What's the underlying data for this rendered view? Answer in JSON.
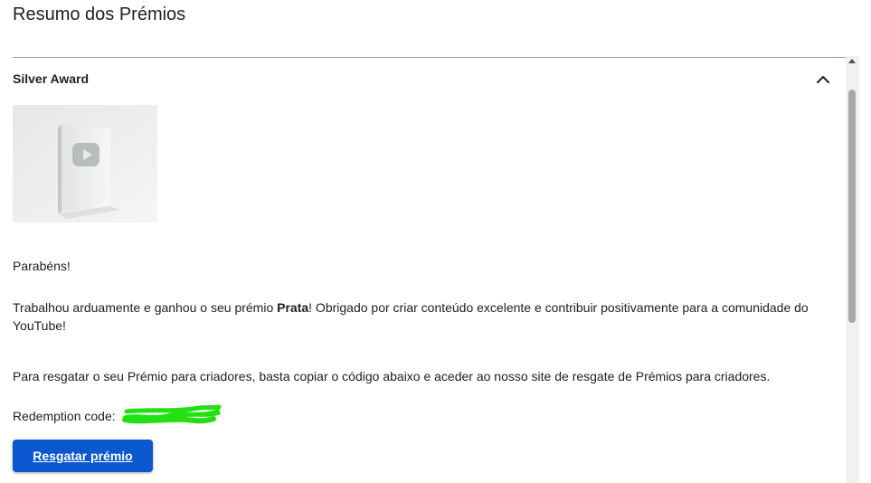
{
  "page": {
    "title": "Resumo dos Prémios"
  },
  "award": {
    "title": "Silver Award",
    "expanded": true,
    "image_description_icon": "youtube-silver-play-button-plaque"
  },
  "message": {
    "congrats": "Parabéns!",
    "body_before": "Trabalhou arduamente e ganhou o seu prémio ",
    "body_bold": "Prata",
    "body_after": "! Obrigado por criar conteúdo excelente e contribuir positivamente para a comunidade do YouTube!",
    "redeem_instructions": "Para resgatar o seu Prémio para criadores, basta copiar o código abaixo e aceder ao nosso site de resgate de Prémios para criadores.",
    "code_label": "Redemption code:"
  },
  "button": {
    "label": "Resgatar prémio"
  },
  "colors": {
    "button_bg": "#0b57d0",
    "redaction": "#22e012",
    "divider": "#9aa0a6"
  }
}
